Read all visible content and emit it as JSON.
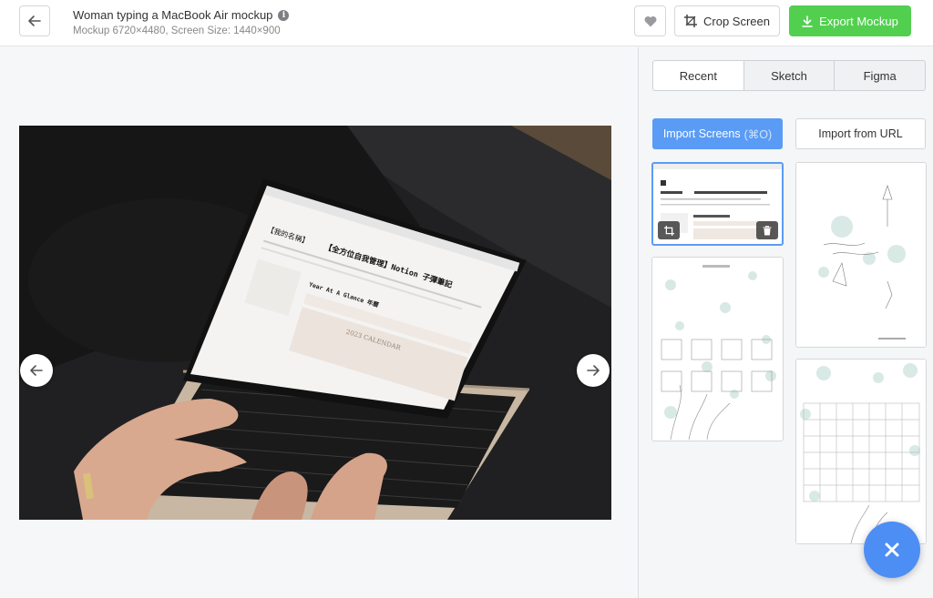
{
  "header": {
    "title": "Woman typing a MacBook Air mockup",
    "subtitle": "Mockup 6720×4480, Screen Size: 1440×900",
    "crop_label": "Crop Screen",
    "export_label": "Export Mockup"
  },
  "sidebar": {
    "tabs": [
      "Recent",
      "Sketch",
      "Figma"
    ],
    "active_tab": "Recent",
    "import_label": "Import Screens",
    "import_shortcut": "(⌘O)",
    "import_url_label": "Import from URL"
  },
  "screen": {
    "page_title": "【全方位自我管理】Notion 子彈筆記",
    "heading_left": "【我的名稱】",
    "section": "Year At A Glance 年曆",
    "calendar_label": "2023 CALENDAR"
  },
  "colors": {
    "accent_blue": "#5a9cf5",
    "export_green": "#52cf4f",
    "fab_blue": "#4d8ef5"
  }
}
